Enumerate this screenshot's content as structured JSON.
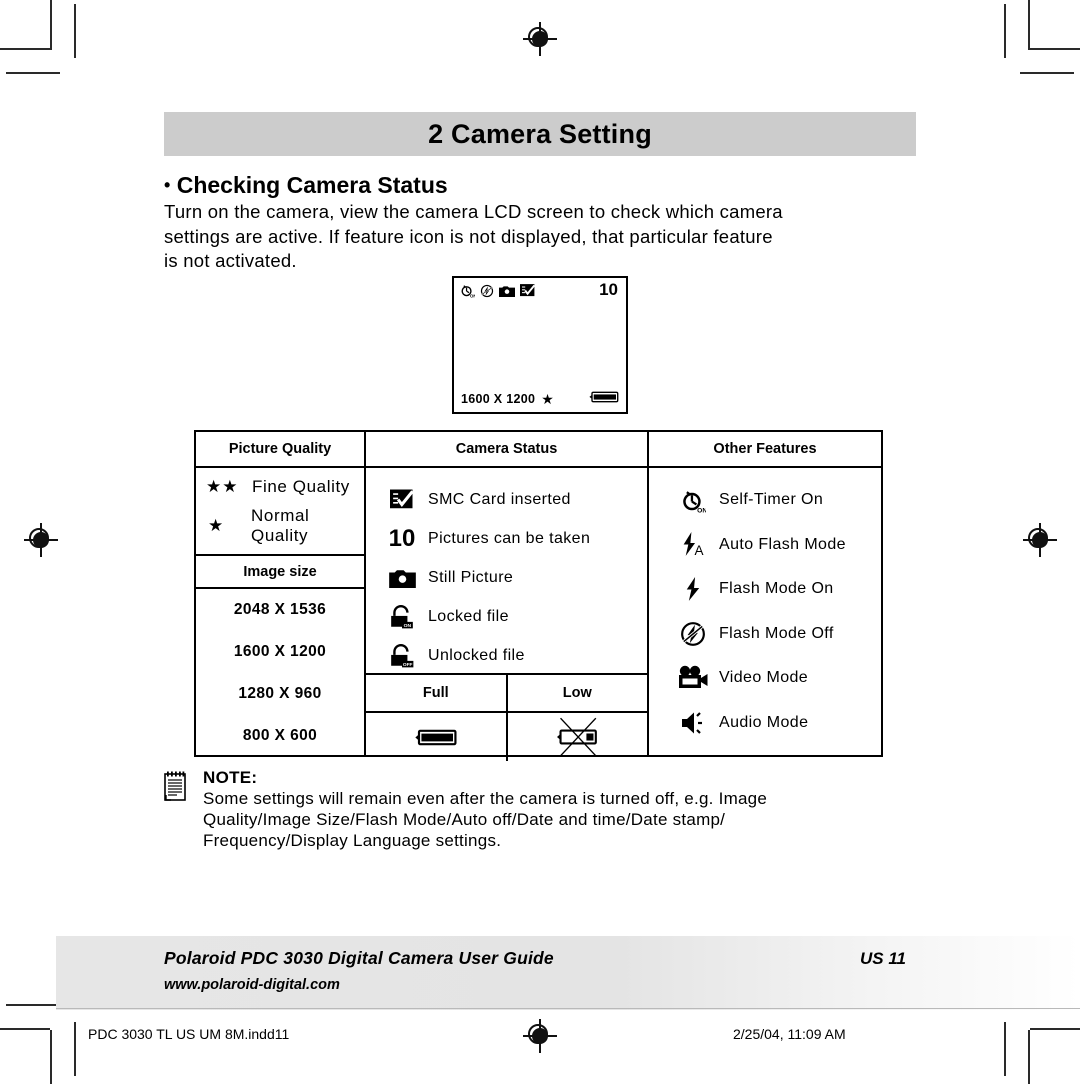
{
  "chapter": {
    "title": "2 Camera Setting"
  },
  "section": {
    "bullet": "•",
    "heading": "Checking Camera Status",
    "paragraph_line1": "Turn on the camera, view the camera LCD screen to check which camera",
    "paragraph_line2": "settings are active. If feature icon is not displayed, that particular feature",
    "paragraph_line3": "is not activated."
  },
  "lcd": {
    "icons": [
      "self-timer-on-icon",
      "flash-mode-off-icon",
      "still-picture-icon",
      "smc-card-icon"
    ],
    "count": "10",
    "resolution": "1600 X 1200",
    "star": "★",
    "battery": "battery-full-icon"
  },
  "table": {
    "headers": {
      "picture_quality": "Picture Quality",
      "camera_status": "Camera Status",
      "other_features": "Other Features"
    },
    "quality_rows": [
      {
        "stars": "★★",
        "label": "Fine Quality"
      },
      {
        "stars": "★",
        "label": "Normal Quality"
      }
    ],
    "image_size_header": "Image size",
    "image_sizes": [
      "2048 X 1536",
      "1600 X 1200",
      "1280 X 960",
      "800 X 600"
    ],
    "status_rows": [
      {
        "icon": "smc-card-icon",
        "label": "SMC Card inserted"
      },
      {
        "icon": "picture-count-10",
        "label": "Pictures can be taken",
        "text": "10"
      },
      {
        "icon": "still-picture-icon",
        "label": "Still Picture"
      },
      {
        "icon": "locked-file-icon",
        "label": "Locked file",
        "badge": "ON"
      },
      {
        "icon": "unlocked-file-icon",
        "label": "Unlocked file",
        "badge": "OFF"
      }
    ],
    "battery_headers": [
      "Full",
      "Low"
    ],
    "battery_icons": [
      "battery-full-icon",
      "battery-low-crossed-icon"
    ],
    "feature_rows": [
      {
        "icon": "self-timer-on-icon",
        "label": "Self-Timer On"
      },
      {
        "icon": "auto-flash-mode-icon",
        "label": "Auto Flash Mode"
      },
      {
        "icon": "flash-mode-on-icon",
        "label": "Flash Mode On"
      },
      {
        "icon": "flash-mode-off-icon",
        "label": "Flash Mode Off"
      },
      {
        "icon": "video-mode-icon",
        "label": "Video Mode"
      },
      {
        "icon": "audio-mode-icon",
        "label": "Audio Mode"
      }
    ]
  },
  "note": {
    "icon": "notepad-icon",
    "title": "NOTE:",
    "line1": "Some settings will remain even after the camera is turned off, e.g. Image",
    "line2": "Quality/Image Size/Flash Mode/Auto off/Date and time/Date stamp/",
    "line3": "Frequency/Display Language settings."
  },
  "footer": {
    "title": "Polaroid PDC 3030 Digital Camera User Guide",
    "page": "US 11",
    "url": "www.polaroid-digital.com",
    "file": "PDC 3030 TL US UM 8M.indd11",
    "timestamp": "2/25/04, 11:09 AM"
  },
  "colors": {
    "chapter_bar": "#cccccc",
    "footer_band": "#e6e6e6",
    "ink": "#000000"
  }
}
